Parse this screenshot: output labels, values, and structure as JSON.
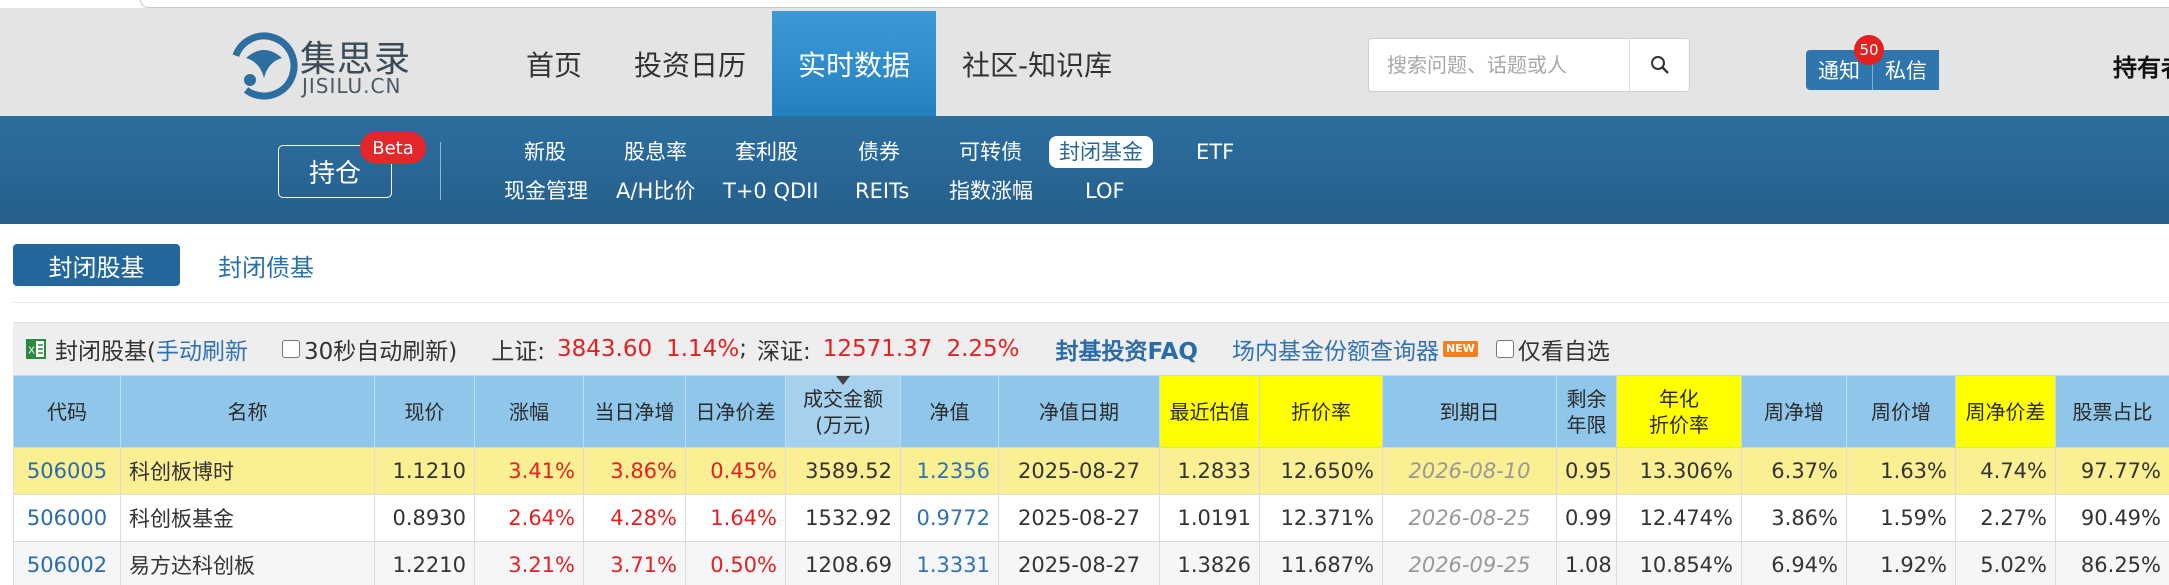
{
  "header": {
    "logo_cn": "集思录",
    "logo_en": "JISILU.CN",
    "nav": [
      "首页",
      "投资日历",
      "实时数据",
      "社区-知识库"
    ],
    "nav_active_index": 2,
    "search_placeholder": "搜索问题、话题或人",
    "notify_label": "通知",
    "message_label": "私信",
    "notify_count": "50",
    "user_text": "持有者"
  },
  "subnav": {
    "holding_label": "持仓",
    "beta_label": "Beta",
    "row1": [
      "新股",
      "股息率",
      "套利股",
      "债券",
      "可转债",
      "封闭基金",
      "ETF"
    ],
    "row2": [
      "现金管理",
      "A/H比价",
      "T+0 QDII",
      "REITs",
      "指数涨幅",
      "LOF"
    ],
    "active": "封闭基金"
  },
  "fund_tabs": {
    "active": "封闭股基",
    "other": "封闭债基"
  },
  "toolbar": {
    "title": "封闭股基(",
    "manual_refresh": "手动刷新",
    "auto_refresh": "30秒自动刷新)",
    "sh_label": "上证:",
    "sh_value": "3843.60",
    "sh_change": "1.14%",
    "sep": ";",
    "sz_label": "深证:",
    "sz_value": "12571.37",
    "sz_change": "2.25%",
    "faq_link": "封基投资FAQ",
    "query_link": "场内基金份额查询器",
    "new_tag": "NEW",
    "watchlist_label": "仅看自选"
  },
  "table": {
    "headers": [
      "代码",
      "名称",
      "现价",
      "涨幅",
      "当日净增",
      "日净价差",
      "成交金额\n(万元)",
      "净值",
      "净值日期",
      "最近估值",
      "折价率",
      "到期日",
      "剩余\n年限",
      "年化\n折价率",
      "周净增",
      "周价增",
      "周净价差",
      "股票占比"
    ],
    "rows": [
      [
        "506005",
        "科创板博时",
        "1.1210",
        "3.41%",
        "3.86%",
        "0.45%",
        "3589.52",
        "1.2356",
        "2025-08-27",
        "1.2833",
        "12.650%",
        "2026-08-10",
        "0.95",
        "13.306%",
        "6.37%",
        "1.63%",
        "4.74%",
        "97.77%"
      ],
      [
        "506000",
        "科创板基金",
        "0.8930",
        "2.64%",
        "4.28%",
        "1.64%",
        "1532.92",
        "0.9772",
        "2025-08-27",
        "1.0191",
        "12.371%",
        "2026-08-25",
        "0.99",
        "12.474%",
        "3.86%",
        "1.59%",
        "2.27%",
        "90.49%"
      ],
      [
        "506002",
        "易方达科创板",
        "1.2210",
        "3.21%",
        "3.71%",
        "0.50%",
        "1208.69",
        "1.3331",
        "2025-08-27",
        "1.3826",
        "11.687%",
        "2026-09-25",
        "1.08",
        "10.854%",
        "6.94%",
        "1.92%",
        "5.02%",
        "86.25%"
      ]
    ]
  },
  "colors": {
    "nav_active": "#2f8bc9",
    "subbar": "#2d6e9f",
    "header_cell": "#8fc6e9",
    "highlight_cell": "#ffff00",
    "row_highlight": "#fbef94",
    "up_red": "#e32121",
    "link_blue": "#2f73b4"
  },
  "icons": {
    "search": "search-icon",
    "excel": "excel-icon",
    "sort": "sort-desc-icon"
  }
}
